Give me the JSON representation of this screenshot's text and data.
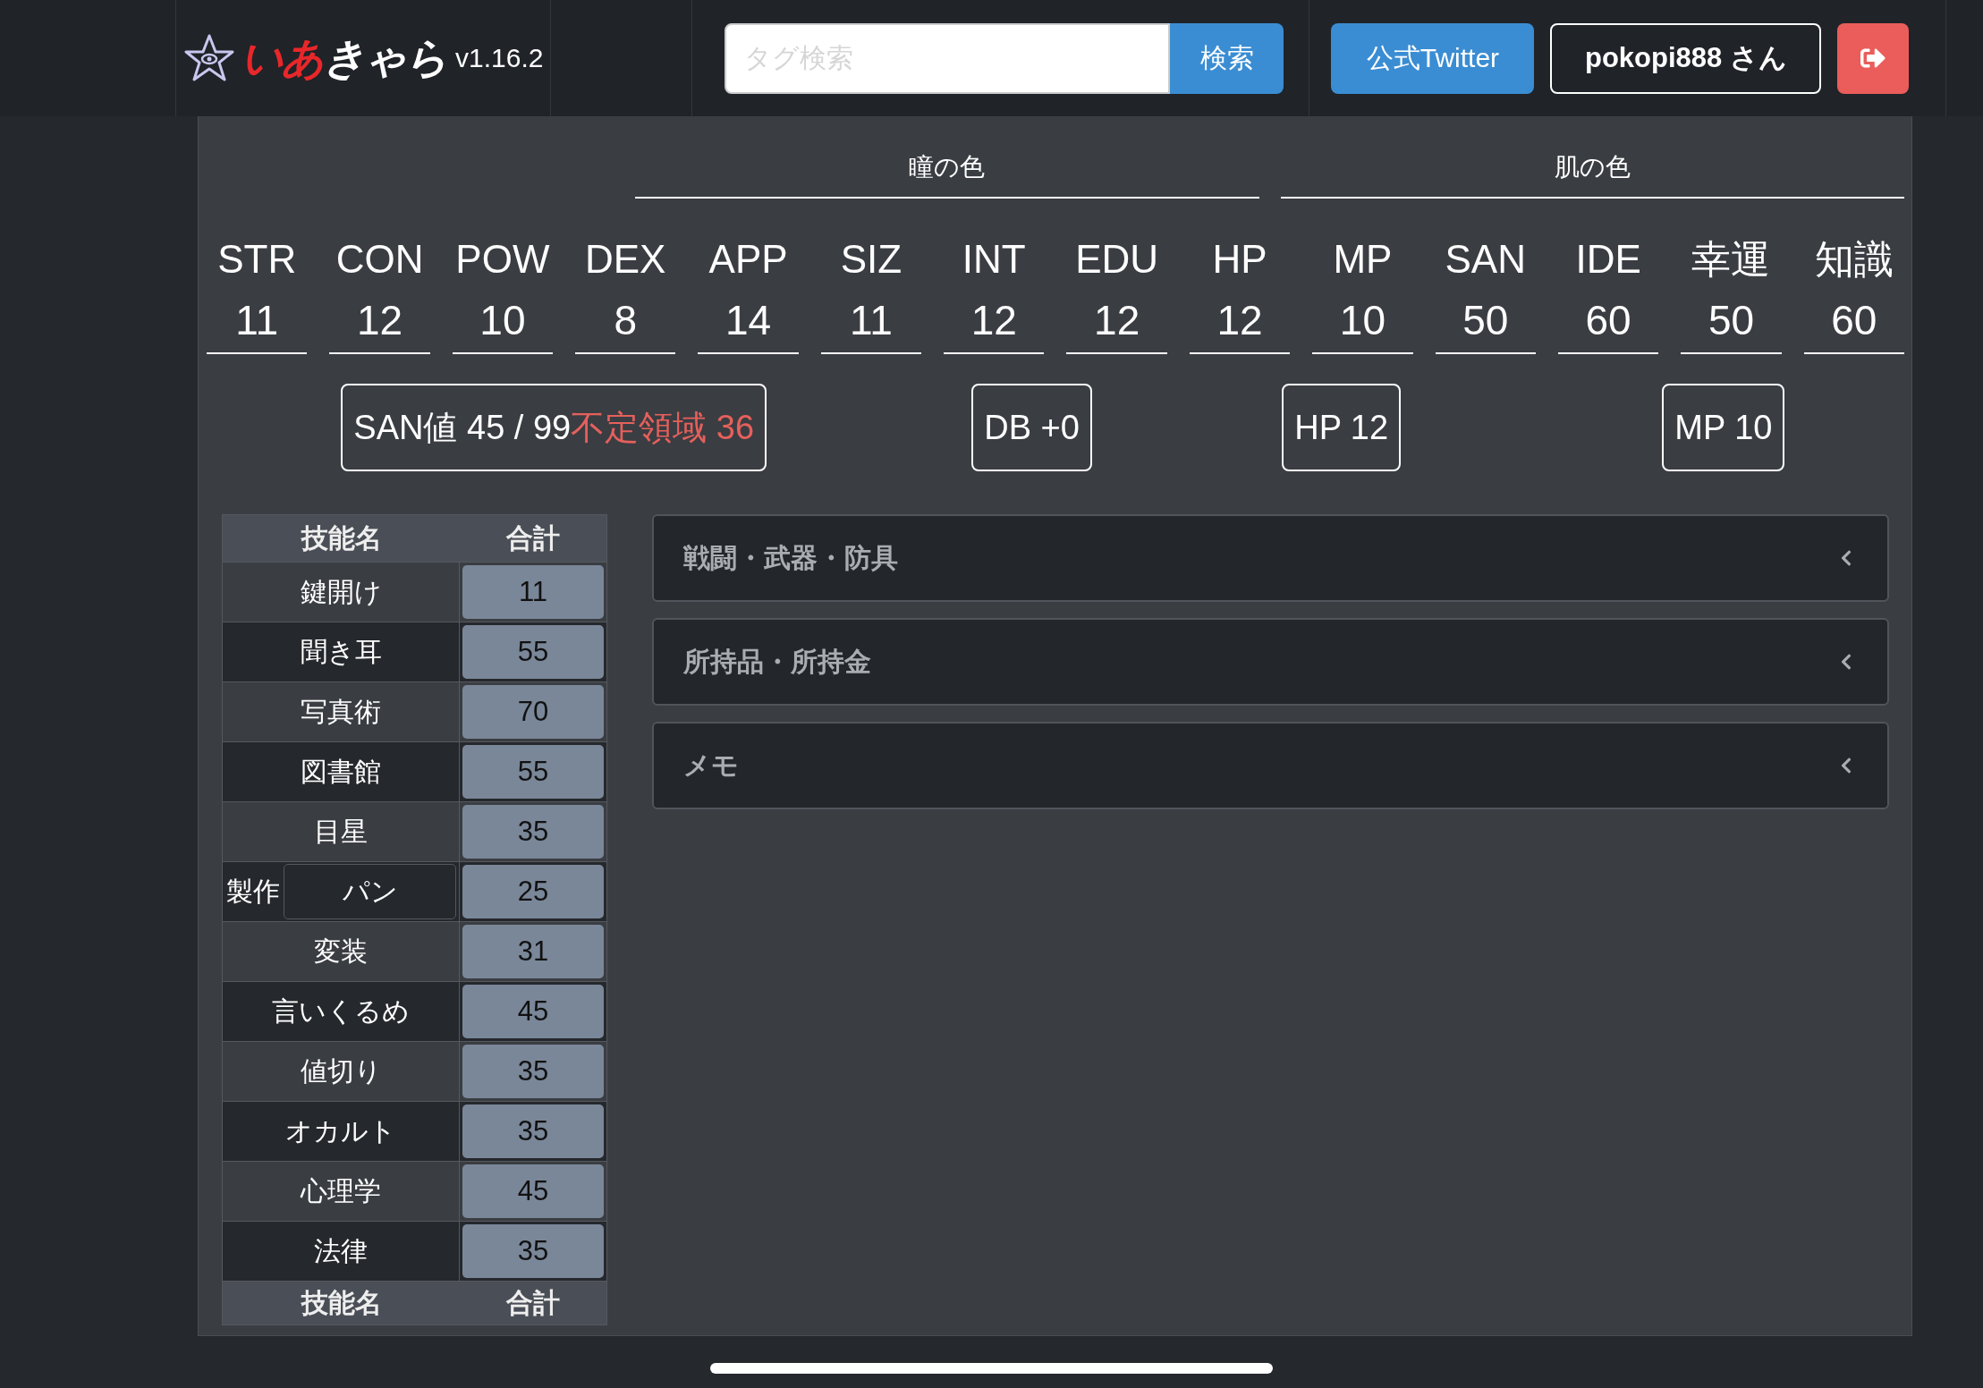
{
  "header": {
    "logo_parts": [
      {
        "text": "いあ",
        "color": "#e8272a"
      },
      {
        "text": "きゃら",
        "color": "#ffffff"
      }
    ],
    "version": "v1.16.2",
    "search": {
      "placeholder": "タグ検索",
      "button": "検索"
    },
    "twitter_button": "公式Twitter",
    "user_button": "pokopi888 さん"
  },
  "profile_fields": [
    {
      "label": "瞳の色"
    },
    {
      "label": "肌の色"
    }
  ],
  "stats": [
    {
      "label": "STR",
      "value": "11"
    },
    {
      "label": "CON",
      "value": "12"
    },
    {
      "label": "POW",
      "value": "10"
    },
    {
      "label": "DEX",
      "value": "8"
    },
    {
      "label": "APP",
      "value": "14"
    },
    {
      "label": "SIZ",
      "value": "11"
    },
    {
      "label": "INT",
      "value": "12"
    },
    {
      "label": "EDU",
      "value": "12"
    },
    {
      "label": "HP",
      "value": "12"
    },
    {
      "label": "MP",
      "value": "10"
    },
    {
      "label": "SAN",
      "value": "50"
    },
    {
      "label": "IDE",
      "value": "60"
    },
    {
      "label": "幸運",
      "value": "50"
    },
    {
      "label": "知識",
      "value": "60"
    }
  ],
  "badges": [
    {
      "kind": "san",
      "text": "SAN値 45 / 99",
      "note": "不定領域 36"
    },
    {
      "kind": "plain",
      "text": "DB +0"
    },
    {
      "kind": "plain",
      "text": "HP 12"
    },
    {
      "kind": "plain",
      "text": "MP 10"
    }
  ],
  "skills": {
    "columns": [
      "技能名",
      "合計"
    ],
    "footer": [
      "技能名",
      "合計"
    ],
    "rows": [
      {
        "kind": "plain",
        "name": "鍵開け",
        "total": "11"
      },
      {
        "kind": "plain",
        "name": "聞き耳",
        "total": "55"
      },
      {
        "kind": "plain",
        "name": "写真術",
        "total": "70"
      },
      {
        "kind": "plain",
        "name": "図書館",
        "total": "55"
      },
      {
        "kind": "plain",
        "name": "目星",
        "total": "35"
      },
      {
        "kind": "custom",
        "prefix": "製作",
        "name": "パン",
        "total": "25"
      },
      {
        "kind": "plain",
        "name": "変装",
        "total": "31"
      },
      {
        "kind": "plain",
        "name": "言いくるめ",
        "total": "45"
      },
      {
        "kind": "plain",
        "name": "値切り",
        "total": "35"
      },
      {
        "kind": "plain",
        "name": "オカルト",
        "total": "35"
      },
      {
        "kind": "plain",
        "name": "心理学",
        "total": "45"
      },
      {
        "kind": "plain",
        "name": "法律",
        "total": "35"
      }
    ]
  },
  "sections": [
    {
      "title": "戦闘・武器・防具",
      "expanded": false
    },
    {
      "title": "所持品・所持金",
      "expanded": false
    },
    {
      "title": "メモ",
      "expanded": false
    }
  ]
}
